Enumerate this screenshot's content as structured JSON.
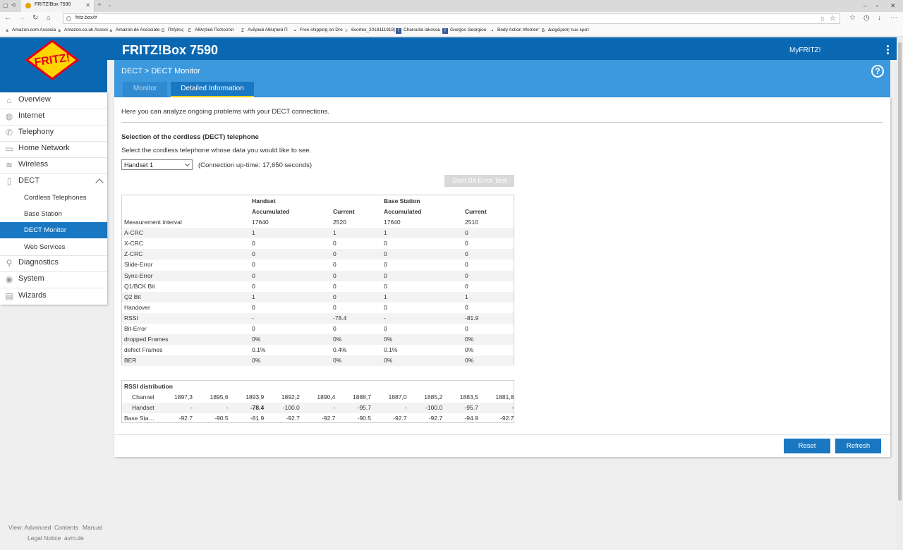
{
  "browser": {
    "tab_title": "FRITZ!Box 7590",
    "url": "fritz.box/#",
    "bookmarks": [
      {
        "label": "Amazon.com Associa",
        "icon": "a"
      },
      {
        "label": "Amazon.co.uk Associ",
        "icon": "a"
      },
      {
        "label": "Amazon.de Associate",
        "icon": "a"
      },
      {
        "label": "Πτήσεις",
        "icon": "G"
      },
      {
        "label": "Αθλητικά Παπούτσι",
        "icon": "Ε"
      },
      {
        "label": "Ανδρικά Αθλητικά Π",
        "icon": "Z"
      },
      {
        "label": "Free shipping on Dre",
        "icon": "▪"
      },
      {
        "label": "6vortex_2018111919(",
        "icon": "☆"
      },
      {
        "label": "Charoulla Iakovou",
        "icon": "f"
      },
      {
        "label": "Giorgos Georgiou",
        "icon": "f"
      },
      {
        "label": "Body Action Women'",
        "icon": "▪"
      },
      {
        "label": "Διαχείριση των κρατ",
        "icon": "B"
      }
    ]
  },
  "header": {
    "logo_text": "FRITZ!",
    "title": "FRITZ!Box 7590",
    "myfritz": "MyFRITZ!"
  },
  "breadcrumb": {
    "part1": "DECT",
    "separator": ">",
    "part2": "DECT Monitor"
  },
  "tabs": [
    {
      "label": "Monitor"
    },
    {
      "label": "Detailed Information"
    }
  ],
  "sidebar": {
    "items": [
      {
        "label": "Overview",
        "icon": "house-icon"
      },
      {
        "label": "Internet",
        "icon": "globe-icon"
      },
      {
        "label": "Telephony",
        "icon": "phone-icon"
      },
      {
        "label": "Home Network",
        "icon": "network-icon"
      },
      {
        "label": "Wireless",
        "icon": "wifi-icon"
      },
      {
        "label": "DECT",
        "icon": "dect-icon"
      },
      {
        "label": "Diagnostics",
        "icon": "diagnostics-icon"
      },
      {
        "label": "System",
        "icon": "system-icon"
      },
      {
        "label": "Wizards",
        "icon": "wizard-icon"
      }
    ],
    "sub_items": [
      {
        "label": "Cordless Telephones"
      },
      {
        "label": "Base Station"
      },
      {
        "label": "DECT Monitor"
      },
      {
        "label": "Web Services"
      }
    ]
  },
  "main": {
    "intro": "Here you can analyze ongoing problems with your DECT connections.",
    "selection_title": "Selection of the cordless (DECT) telephone",
    "selection_desc": "Select the cordless telephone whose data you would like to see.",
    "selected_handset": "Handset 1",
    "uptime": "(Connection up-time: 17,650 seconds)",
    "bit_error_button": "Start Bit Error Test"
  },
  "table": {
    "group_handset": "Handset",
    "group_base": "Base Station",
    "col_accumulated": "Accumulated",
    "col_current": "Current",
    "rows": [
      {
        "label": "Measurement interval",
        "h_acc": "17640",
        "h_cur": "2520",
        "b_acc": "17640",
        "b_cur": "2510"
      },
      {
        "label": "A-CRC",
        "h_acc": "1",
        "h_cur": "1",
        "b_acc": "1",
        "b_cur": "0"
      },
      {
        "label": "X-CRC",
        "h_acc": "0",
        "h_cur": "0",
        "b_acc": "0",
        "b_cur": "0"
      },
      {
        "label": "Z-CRC",
        "h_acc": "0",
        "h_cur": "0",
        "b_acc": "0",
        "b_cur": "0"
      },
      {
        "label": "Slide-Error",
        "h_acc": "0",
        "h_cur": "0",
        "b_acc": "0",
        "b_cur": "0"
      },
      {
        "label": "Sync-Error",
        "h_acc": "0",
        "h_cur": "0",
        "b_acc": "0",
        "b_cur": "0"
      },
      {
        "label": "Q1/BCK Bit",
        "h_acc": "0",
        "h_cur": "0",
        "b_acc": "0",
        "b_cur": "0"
      },
      {
        "label": "Q2 Bit",
        "h_acc": "1",
        "h_cur": "0",
        "b_acc": "1",
        "b_cur": "1"
      },
      {
        "label": "Handover",
        "h_acc": "0",
        "h_cur": "0",
        "b_acc": "0",
        "b_cur": "0"
      },
      {
        "label": "RSSI",
        "h_acc": "-",
        "h_cur": "-78.4",
        "b_acc": "-",
        "b_cur": "-81.9"
      },
      {
        "label": "Bit-Error",
        "h_acc": "0",
        "h_cur": "0",
        "b_acc": "0",
        "b_cur": "0"
      },
      {
        "label": "dropped Frames",
        "h_acc": "0%",
        "h_cur": "0%",
        "b_acc": "0%",
        "b_cur": "0%"
      },
      {
        "label": "defect Frames",
        "h_acc": "0.1%",
        "h_cur": "0.4%",
        "b_acc": "0.1%",
        "b_cur": "0%"
      },
      {
        "label": "BER",
        "h_acc": "0%",
        "h_cur": "0%",
        "b_acc": "0%",
        "b_cur": "0%"
      }
    ]
  },
  "rssi": {
    "title": "RSSI distribution",
    "row_labels": [
      "Channel",
      "Handset",
      "Base Sta…"
    ],
    "channels": [
      "1897,3",
      "1895,6",
      "1893,9",
      "1892,2",
      "1890,4",
      "1888,7",
      "1887,0",
      "1885,2",
      "1883,5",
      "1881,8"
    ],
    "handset": [
      "-",
      "-",
      "-78.4",
      "-100.0",
      "-",
      "-95.7",
      "-",
      "-100.0",
      "-95.7",
      "-"
    ],
    "base": [
      "-92.7",
      "-90.5",
      "-81.9",
      "-92.7",
      "-92.7",
      "-90.5",
      "-92.7",
      "-92.7",
      "-94.9",
      "-92.7"
    ]
  },
  "buttons": {
    "reset": "Reset",
    "refresh": "Refresh"
  },
  "footer": {
    "view": "View: Advanced",
    "contents": "Contents",
    "manual": "Manual",
    "legal": "Legal Notice",
    "avm": "avm.de"
  },
  "colors": {
    "header_blue": "#0a68b3",
    "subheader_blue": "#3c99de",
    "accent_blue": "#1a78c2",
    "tab_underline": "#ffd400"
  }
}
